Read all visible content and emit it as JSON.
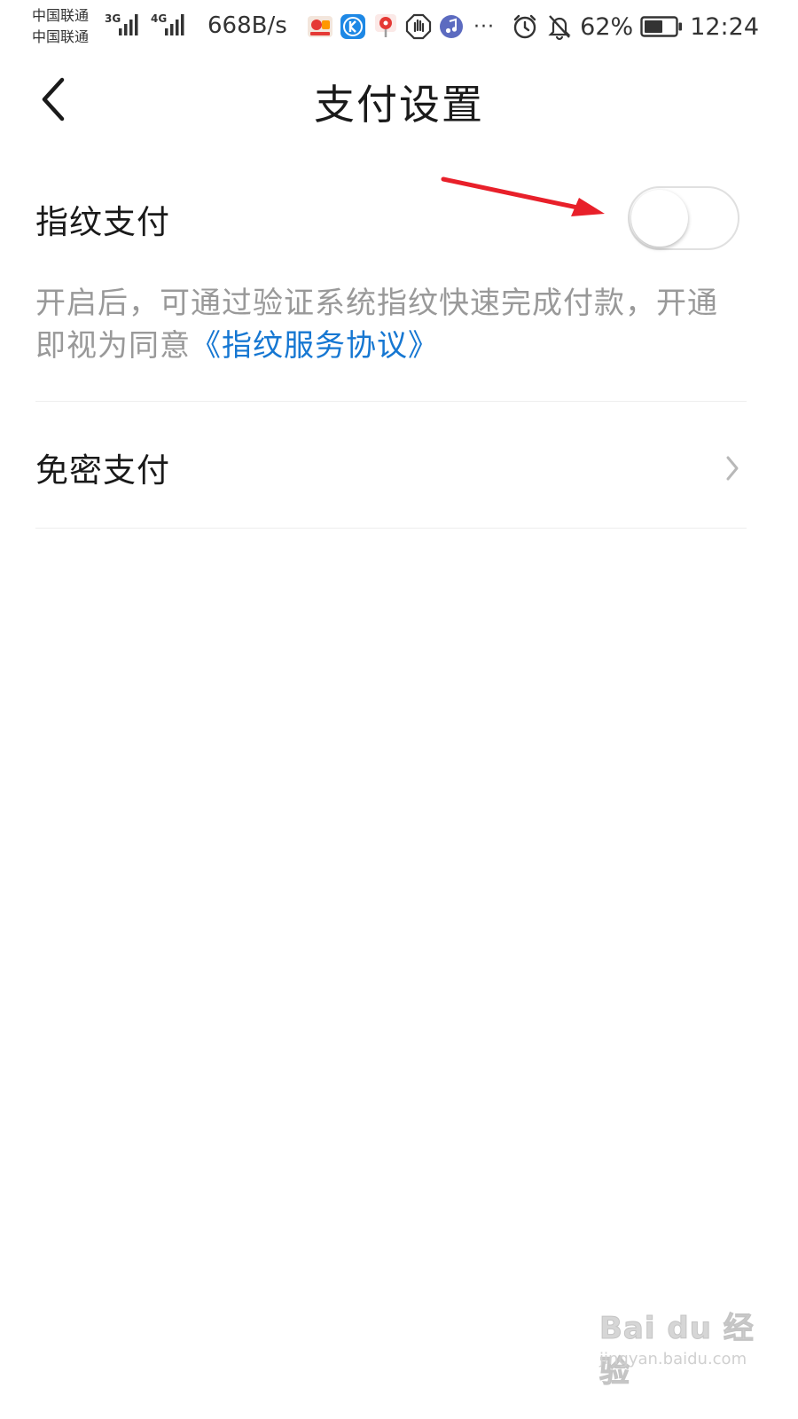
{
  "status_bar": {
    "carrier_1": "中国联通",
    "carrier_2": "中国联通",
    "network_1": "3G",
    "network_2": "4G",
    "net_speed": "668B/s",
    "more_dots": "···",
    "battery_percent": "62%",
    "battery_level": 0.62,
    "time": "12:24"
  },
  "header": {
    "title": "支付设置"
  },
  "fingerprint_pay": {
    "label": "指纹支付",
    "enabled": false,
    "description": "开启后，可通过验证系统指纹快速完成付款，开通即视为同意",
    "agreement_link": "《指纹服务协议》"
  },
  "password_free_pay": {
    "label": "免密支付"
  },
  "watermark": {
    "logo_text": "Bai du 经验",
    "url": "jingyan.baidu.com"
  },
  "colors": {
    "link": "#1677d2",
    "description_text": "#999999",
    "annotation_arrow": "#e8202a",
    "divider": "#eeeeee"
  },
  "icons": {
    "back": "chevron-left-icon",
    "row_nav": "chevron-right-icon",
    "alarm": "alarm-clock-icon",
    "mute": "bell-off-icon",
    "battery": "battery-icon"
  }
}
